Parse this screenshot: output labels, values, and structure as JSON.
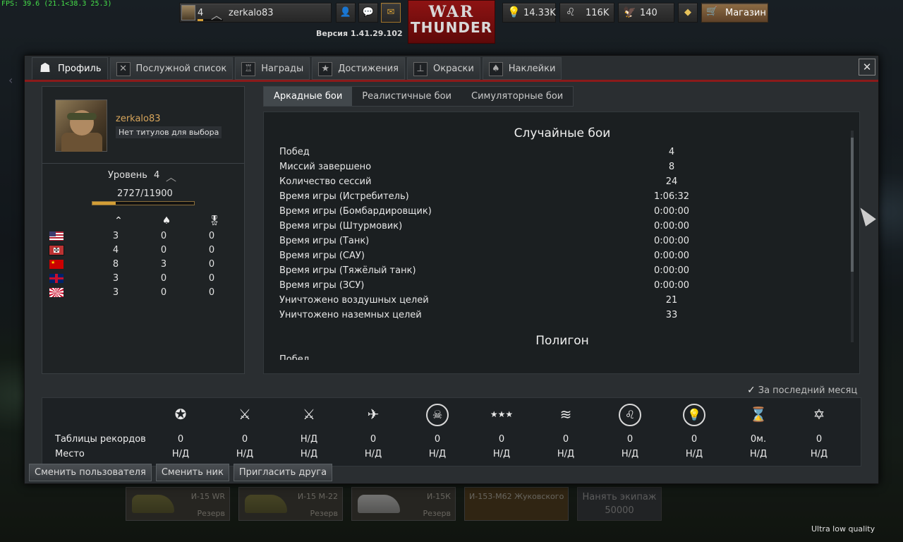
{
  "fps": "FPS: 39.6 (21.1<38.3 25.3)",
  "topbar": {
    "rank_num": "4",
    "username": "zerkalo83",
    "version": "Версия 1.41.29.102",
    "logo_line1": "WAR",
    "logo_line2": "THUNDER",
    "research_points": "14.33K",
    "silver_lions": "116K",
    "golden_eagles": "140",
    "shop_label": "Магазин"
  },
  "tabs": [
    {
      "label": "Профиль",
      "icon": "pilot-icon"
    },
    {
      "label": "Послужной список",
      "icon": "crossed-swords-icon"
    },
    {
      "label": "Награды",
      "icon": "trophy-icon"
    },
    {
      "label": "Достижения",
      "icon": "star-icon"
    },
    {
      "label": "Окраски",
      "icon": "paint-icon"
    },
    {
      "label": "Наклейки",
      "icon": "spade-icon"
    }
  ],
  "profile": {
    "name": "zerkalo83",
    "title_option": "Нет титулов для выбора",
    "level_label": "Уровень",
    "level": "4",
    "experience": "2727/11900",
    "experience_progress": 0.229
  },
  "nations": {
    "rows": [
      {
        "flag": "usa",
        "a": "3",
        "b": "0",
        "c": "0"
      },
      {
        "flag": "germany",
        "a": "4",
        "b": "0",
        "c": "0"
      },
      {
        "flag": "ussr",
        "a": "8",
        "b": "3",
        "c": "0"
      },
      {
        "flag": "britain",
        "a": "3",
        "b": "0",
        "c": "0"
      },
      {
        "flag": "japan",
        "a": "3",
        "b": "0",
        "c": "0"
      }
    ]
  },
  "modes": [
    "Аркадные бои",
    "Реалистичные бои",
    "Симуляторные бои"
  ],
  "stats": {
    "section_title": "Случайные бои",
    "rows": [
      {
        "label": "Побед",
        "value": "4"
      },
      {
        "label": "Миссий завершено",
        "value": "8"
      },
      {
        "label": "Количество сессий",
        "value": "24"
      },
      {
        "label": "Время игры (Истребитель)",
        "value": "1:06:32"
      },
      {
        "label": "Время игры (Бомбардировщик)",
        "value": "0:00:00"
      },
      {
        "label": "Время игры (Штурмовик)",
        "value": "0:00:00"
      },
      {
        "label": "Время игры (Танк)",
        "value": "0:00:00"
      },
      {
        "label": "Время игры (САУ)",
        "value": "0:00:00"
      },
      {
        "label": "Время игры (Тяжёлый танк)",
        "value": "0:00:00"
      },
      {
        "label": "Время игры (ЗСУ)",
        "value": "0:00:00"
      },
      {
        "label": "Уничтожено воздушных целей",
        "value": "21"
      },
      {
        "label": "Уничтожено наземных целей",
        "value": "33"
      }
    ],
    "section2_title": "Полигон",
    "section2_partial": "Побед"
  },
  "records": {
    "last_month_label": "За последний месяц",
    "row1_label": "Таблицы рекордов",
    "row2_label": "Место",
    "columns": [
      {
        "icon": "wing-star-icon",
        "glyph": "✪",
        "v1": "0",
        "v2": "Н/Д"
      },
      {
        "icon": "crossed-swords-icon",
        "glyph": "⚔",
        "v1": "0",
        "v2": "Н/Д"
      },
      {
        "icon": "crossed-swords-star-icon",
        "glyph": "⚔",
        "v1": "Н/Д",
        "v2": "Н/Д"
      },
      {
        "icon": "plane-icon",
        "glyph": "✈",
        "v1": "0",
        "v2": "Н/Д"
      },
      {
        "icon": "skull-icon",
        "glyph": "☠",
        "v1": "0",
        "v2": "Н/Д"
      },
      {
        "icon": "three-stars-icon",
        "glyph": "★★★",
        "v1": "0",
        "v2": "Н/Д"
      },
      {
        "icon": "formation-icon",
        "glyph": "≋",
        "v1": "0",
        "v2": "Н/Д"
      },
      {
        "icon": "lion-icon",
        "glyph": "♌",
        "v1": "0",
        "v2": "Н/Д"
      },
      {
        "icon": "lightbulb-icon",
        "glyph": "💡",
        "v1": "0",
        "v2": "Н/Д"
      },
      {
        "icon": "time-icon",
        "glyph": "⌛",
        "v1": "0м.",
        "v2": "Н/Д"
      },
      {
        "icon": "star-diamond-icon",
        "glyph": "✡",
        "v1": "0",
        "v2": "Н/Д"
      }
    ]
  },
  "bottom_buttons": [
    "Сменить пользователя",
    "Сменить ник",
    "Пригласить друга"
  ],
  "hangar": {
    "vehicles": [
      {
        "name": "И-15 WR",
        "status": "Резерв"
      },
      {
        "name": "И-15 М-22",
        "status": "Резерв"
      },
      {
        "name": "И-15К",
        "status": "Резерв"
      },
      {
        "name": "И-153-М62 Жуковского",
        "status": ""
      }
    ],
    "hire_label": "Нанять экипаж",
    "hire_cost": "50000"
  },
  "quality": "Ultra low quality"
}
